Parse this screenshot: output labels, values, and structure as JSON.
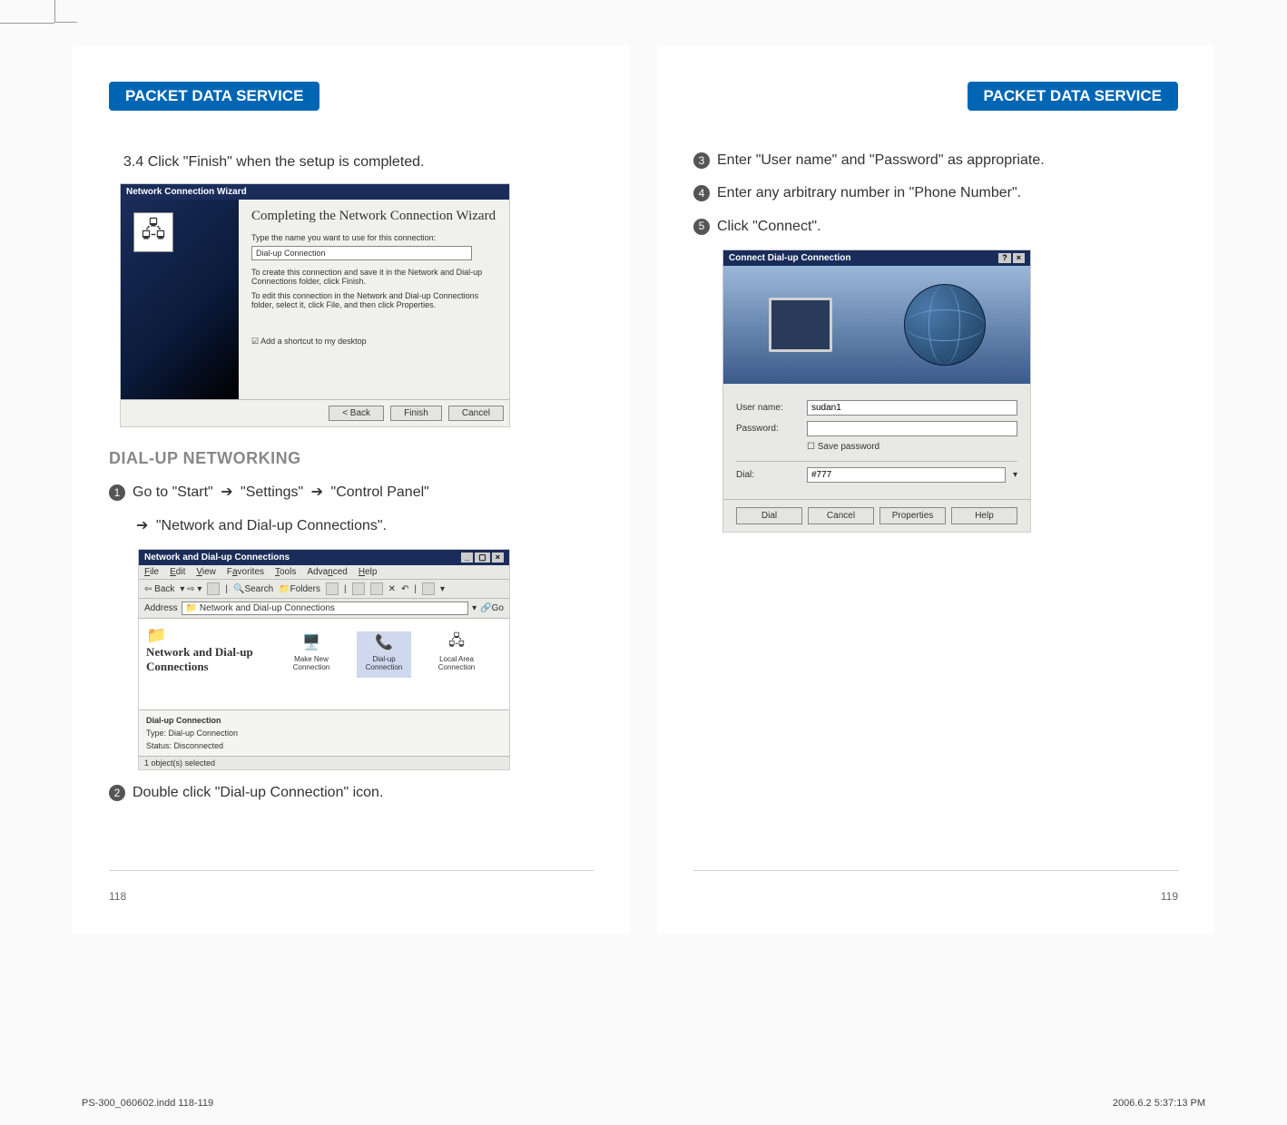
{
  "header": {
    "left_badge": "PACKET DATA SERVICE",
    "right_badge": "PACKET DATA SERVICE"
  },
  "left_page": {
    "step_3_4": "3.4 Click \"Finish\" when the setup is completed.",
    "wizard": {
      "titlebar": "Network Connection Wizard",
      "heading": "Completing the Network Connection Wizard",
      "line_name_prompt": "Type the name you want to use for this connection:",
      "input_value": "Dial-up Connection",
      "desc1": "To create this connection and save it in the Network and Dial-up Connections folder, click Finish.",
      "desc2": "To edit this connection in the Network and Dial-up Connections folder, select it, click File, and then click Properties.",
      "checkbox": "Add a shortcut to my desktop",
      "btn_back": "< Back",
      "btn_finish": "Finish",
      "btn_cancel": "Cancel"
    },
    "section_heading": "DIAL-UP NETWORKING",
    "step1_a": "Go to \"Start\"",
    "step1_b": "\"Settings\"",
    "step1_c": "\"Control Panel\"",
    "step1_d": "\"Network and Dial-up Connections\".",
    "explorer": {
      "titlebar": "Network and Dial-up Connections",
      "menu_file": "File",
      "menu_edit": "Edit",
      "menu_view": "View",
      "menu_fav": "Favorites",
      "menu_tools": "Tools",
      "menu_adv": "Advanced",
      "menu_help": "Help",
      "tb_back": "Back",
      "tb_search": "Search",
      "tb_folders": "Folders",
      "addr_label": "Address",
      "addr_value": "Network and Dial-up Connections",
      "addr_go": "Go",
      "heading": "Network and Dial-up Connections",
      "icon_make": "Make New Connection",
      "icon_dial": "Dial-up Connection",
      "icon_local": "Local Area Connection",
      "sel_name": "Dial-up Connection",
      "sel_type": "Type: Dial-up Connection",
      "sel_status": "Status: Disconnected",
      "footer": "1 object(s) selected"
    },
    "step2": "Double click \"Dial-up Connection\" icon."
  },
  "right_page": {
    "step3": "Enter \"User name\" and \"Password\" as appropriate.",
    "step4": "Enter any arbitrary number in \"Phone Number\".",
    "step5": "Click \"Connect\".",
    "connect": {
      "titlebar": "Connect Dial-up Connection",
      "label_user": "User name:",
      "value_user": "sudan1",
      "label_pass": "Password:",
      "check_save": "Save password",
      "label_dial": "Dial:",
      "value_dial": "#777",
      "btn_dial": "Dial",
      "btn_cancel": "Cancel",
      "btn_props": "Properties",
      "btn_help": "Help"
    }
  },
  "page_numbers": {
    "left": "118",
    "right": "119"
  },
  "footer": {
    "filename": "PS-300_060602.indd   118-119",
    "timestamp": "2006.6.2   5:37:13 PM"
  }
}
